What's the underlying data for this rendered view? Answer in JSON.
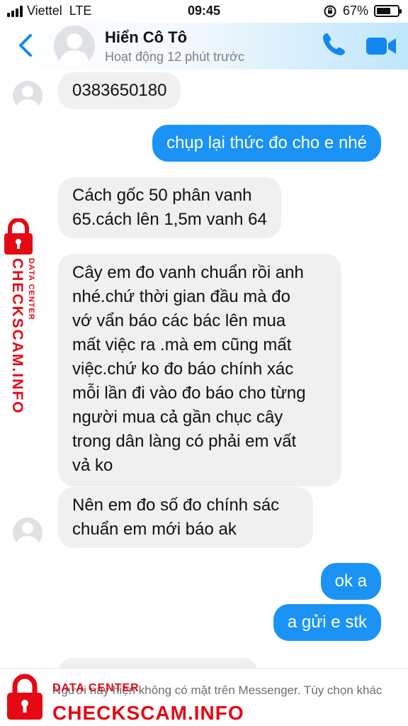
{
  "status_bar": {
    "carrier": "Viettel",
    "network": "LTE",
    "time": "09:45",
    "battery_text": "67%",
    "battery_level": 0.67
  },
  "header": {
    "contact_name": "Hiển Cô Tô",
    "activity": "Hoạt động 12 phút trước",
    "icons": [
      "back-chevron-icon",
      "avatar",
      "phone-call-icon",
      "video-camera-icon"
    ],
    "accent_color": "#1287f1"
  },
  "messages": [
    {
      "from": "them",
      "text": "0383650180"
    },
    {
      "from": "me",
      "text": "chụp lại thức đo cho e nhé"
    },
    {
      "from": "them",
      "text": "Cách gốc 50 phân vanh\n65.cách lên 1,5m vanh 64"
    },
    {
      "from": "them",
      "text": "Cây em đo vanh chuẩn rồi anh\nnhé.chứ thời gian đầu mà đo\nvớ vẩn báo các bác lên mua\nmất việc ra .mà em cũng mất\nviệc.chứ ko đo báo chính xác\nmỗi lần đi vào đo báo cho từng\nngười mua cả gần chục cây\ntrong dân làng có phải em vất\nvả ko"
    },
    {
      "from": "them",
      "text": "Nên em đo số đo chính sác\nchuẩn em mới báo ak"
    },
    {
      "from": "me",
      "text": "ok a"
    },
    {
      "from": "me",
      "text": "a gửi e stk"
    }
  ],
  "bubble_colors": {
    "outgoing": "#1a93f5",
    "incoming": "#f0f0f0"
  },
  "bottom_bar": {
    "notice": "Người này hiện không có mặt trên Messenger. Tùy chọn khác"
  },
  "watermark": {
    "brand": "CHECKSCAM.INFO",
    "sub": "DATA CENTER",
    "color": "#e50914",
    "icon": "padlock-icon"
  }
}
